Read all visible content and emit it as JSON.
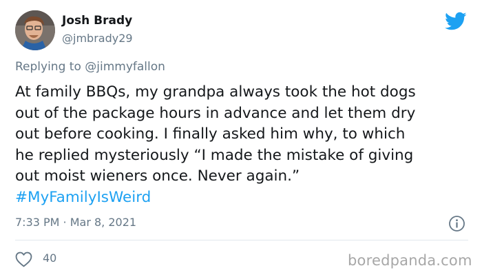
{
  "user": {
    "display_name": "Josh Brady",
    "handle": "@jmbrady29"
  },
  "reply": {
    "prefix": "Replying to ",
    "mention": "@jimmyfallon"
  },
  "tweet": {
    "lines": [
      "At family BBQs, my grandpa always took the hot dogs",
      "out of the package hours in advance and let them dry",
      "out before cooking. I finally asked him why, to which",
      "he replied mysteriously “I made the mistake of giving",
      "out moist wieners once. Never again.”"
    ],
    "hashtag": "#MyFamilyIsWeird"
  },
  "meta": {
    "timestamp": "7:33 PM · Mar 8, 2021"
  },
  "actions": {
    "like_count": "40"
  },
  "watermark": "boredpanda.com",
  "colors": {
    "twitter_blue": "#1da1f2",
    "secondary_text": "#657786",
    "primary_text": "#14171a"
  },
  "icons": {
    "brand": "twitter-bird-icon",
    "info": "info-icon",
    "like": "heart-icon"
  }
}
